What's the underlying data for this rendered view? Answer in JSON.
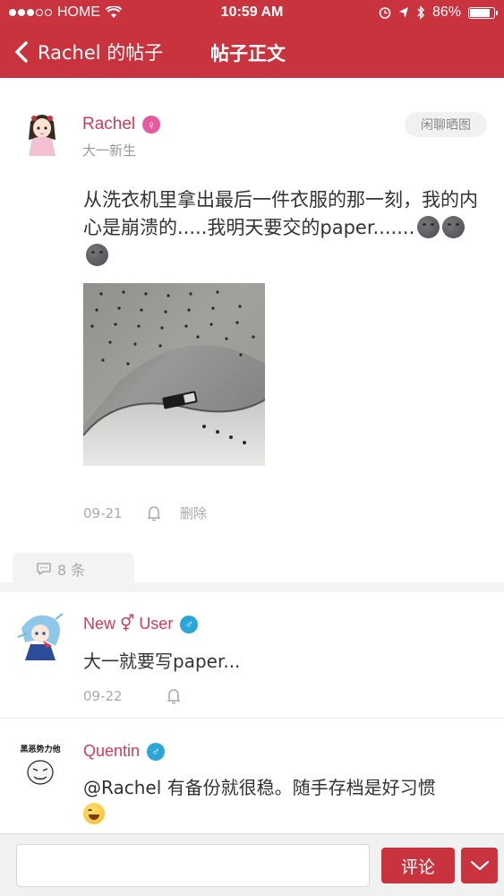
{
  "status_bar": {
    "carrier": "HOME",
    "time": "10:59 AM",
    "battery": "86%",
    "battery_level": 0.86
  },
  "nav": {
    "back_label": "Rachel 的帖子",
    "title": "帖子正文"
  },
  "post": {
    "author": "Rachel",
    "gender": "♀",
    "subtitle": "大一新生",
    "category": "闲聊晒图",
    "text": "从洗衣机里拿出最后一件衣服的那一刻，我的内心是崩溃的.....我明天要交的paper.......",
    "date": "09-21",
    "delete_label": "删除"
  },
  "comments_header": {
    "count_label": "8 条"
  },
  "comments": [
    {
      "author": "New",
      "author_symbol": "⚥",
      "author_suffix": "User",
      "gender": "♂",
      "text": "大一就要写paper...",
      "date": "09-22"
    },
    {
      "author": "Quentin",
      "gender": "♂",
      "avatar_text": "黑恶势力他",
      "text": "@Rachel  有备份就很稳。随手存档是好习惯"
    }
  ],
  "bottom_bar": {
    "input_placeholder": "",
    "submit_label": "评论"
  },
  "colors": {
    "brand": "#c8333d",
    "author_name": "#d03a5a",
    "female": "#e85aa0",
    "male": "#2aa6d8"
  },
  "icons": [
    "chevron-left-icon",
    "wifi-icon",
    "signal-icon",
    "alarm-icon",
    "location-arrow-icon",
    "bluetooth-icon",
    "battery-icon",
    "female-icon",
    "male-icon",
    "bell-icon",
    "comment-bubble-icon",
    "chevron-down-icon"
  ]
}
